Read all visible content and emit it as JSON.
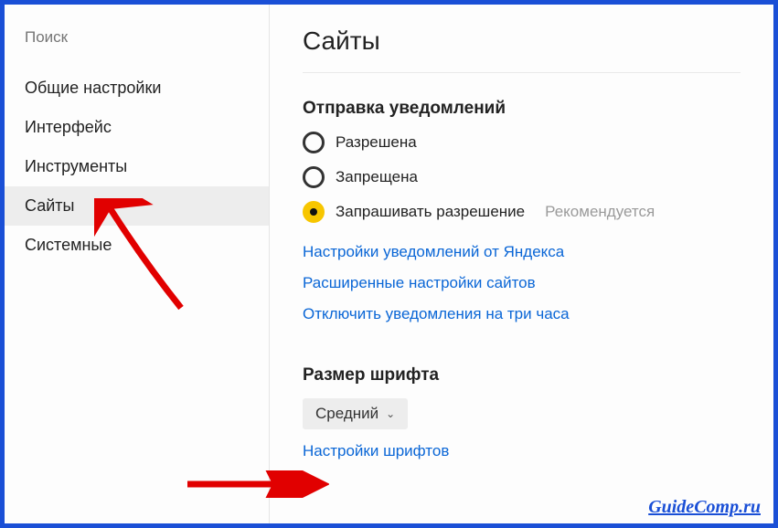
{
  "search": {
    "placeholder": "Поиск"
  },
  "sidebar": {
    "items": [
      {
        "label": "Общие настройки"
      },
      {
        "label": "Интерфейс"
      },
      {
        "label": "Инструменты"
      },
      {
        "label": "Сайты"
      },
      {
        "label": "Системные"
      }
    ],
    "active_index": 3
  },
  "main": {
    "title": "Сайты",
    "notifications": {
      "heading": "Отправка уведомлений",
      "options": [
        {
          "label": "Разрешена",
          "selected": false
        },
        {
          "label": "Запрещена",
          "selected": false
        },
        {
          "label": "Запрашивать разрешение",
          "selected": true,
          "hint": "Рекомендуется"
        }
      ],
      "links": [
        "Настройки уведомлений от Яндекса",
        "Расширенные настройки сайтов",
        "Отключить уведомления на три часа"
      ]
    },
    "font": {
      "heading": "Размер шрифта",
      "value": "Средний",
      "link": "Настройки шрифтов"
    }
  },
  "watermark": "GuideComp.ru"
}
